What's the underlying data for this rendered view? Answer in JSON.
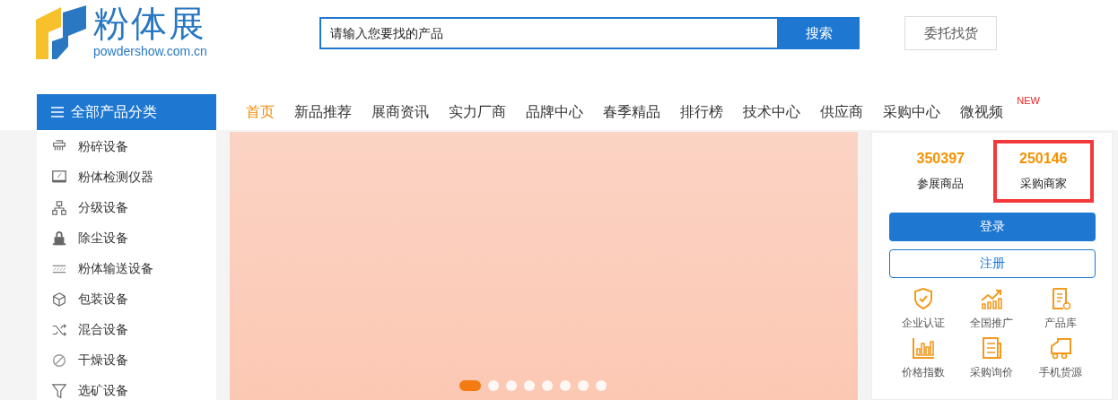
{
  "logo": {
    "name": "粉体展",
    "domain": "powdershow.com.cn"
  },
  "search": {
    "placeholder": "请输入您要找的产品",
    "button": "搜索"
  },
  "entrust_button": "委托找货",
  "category_menu": {
    "title": "全部产品分类",
    "items": [
      {
        "label": "粉碎设备"
      },
      {
        "label": "粉体检测仪器"
      },
      {
        "label": "分级设备"
      },
      {
        "label": "除尘设备"
      },
      {
        "label": "粉体输送设备"
      },
      {
        "label": "包装设备"
      },
      {
        "label": "混合设备"
      },
      {
        "label": "干燥设备"
      },
      {
        "label": "选矿设备"
      }
    ]
  },
  "nav": [
    {
      "label": "首页",
      "selected": true
    },
    {
      "label": "新品推荐",
      "selected": false
    },
    {
      "label": "展商资讯",
      "selected": false
    },
    {
      "label": "实力厂商",
      "selected": false
    },
    {
      "label": "品牌中心",
      "selected": false
    },
    {
      "label": "春季精品",
      "selected": false
    },
    {
      "label": "排行榜",
      "selected": false
    },
    {
      "label": "技术中心",
      "selected": false
    },
    {
      "label": "供应商",
      "selected": false
    },
    {
      "label": "采购中心",
      "selected": false
    },
    {
      "label": "微视频",
      "selected": false,
      "badge": "NEW"
    }
  ],
  "banner": {
    "dots": [
      {
        "selected": true
      },
      {
        "selected": false
      },
      {
        "selected": false
      },
      {
        "selected": false
      },
      {
        "selected": false
      },
      {
        "selected": false
      },
      {
        "selected": false
      },
      {
        "selected": false
      }
    ]
  },
  "stats": [
    {
      "value": "350397",
      "label": "参展商品",
      "highlighted": false
    },
    {
      "value": "250146",
      "label": "采购商家",
      "highlighted": true
    }
  ],
  "login_button": "登录",
  "register_button": "注册",
  "services": [
    {
      "label": "企业认证"
    },
    {
      "label": "全国推广"
    },
    {
      "label": "产品库"
    },
    {
      "label": "价格指数"
    },
    {
      "label": "采购询价"
    },
    {
      "label": "手机货源"
    }
  ]
}
